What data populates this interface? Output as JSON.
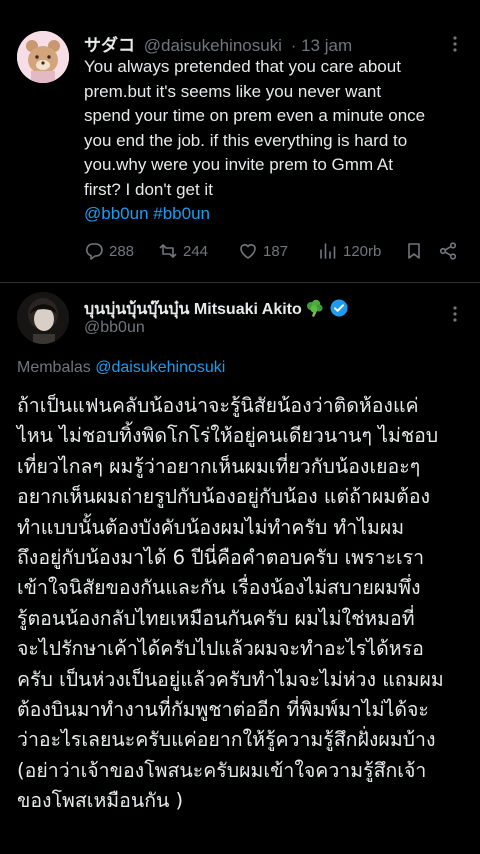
{
  "tweet1": {
    "display_name": "サダコ",
    "handle": "@daisukehinosuki",
    "time": "· 13 jam",
    "lines": [
      "You always pretended that you care about",
      "prem.but it's seems like you never want",
      "spend your time on prem  even a minute once",
      "you end the job. if this everything is hard to",
      "you.why were you invite prem to Gmm At",
      "first? I don't get it"
    ],
    "hashtags": "@bb0un #bb0un",
    "replies": "288",
    "retweets": "244",
    "likes": "187",
    "views": "120rb"
  },
  "tweet2": {
    "display_name": "บุนบุ่นบุ้นบุ๊นบุ๋น Mitsuaki Akito",
    "handle": "@bb0un",
    "reply_prefix": "Membalas",
    "reply_to": "@daisukehinosuki",
    "lines": [
      "ถ้าเป็นแฟนคลับน้องน่าจะรู้นิสัยน้องว่าติดห้องแค่",
      "ไหน ไม่ชอบทิ้งพิดโกโร่ให้อยู่คนเดียวนานๆ ไม่ชอบ",
      "เที่ยวไกลๆ ผมรู้ว่าอยากเห็นผมเที่ยวกับน้องเยอะๆ",
      "อยากเห็นผมถ่ายรูปกับน้องอยู่กับน้อง แต่ถ้าผมต้อง",
      "ทำแบบนั้นต้องบังคับน้องผมไม่ทำครับ ทำไมผม",
      "ถึงอยู่กับน้องมาได้ 6 ปีนี่คือคำตอบครับ เพราะเรา",
      "เข้าใจนิสัยของกันและกัน เรื่องน้องไม่สบายผมพึ่ง",
      "รู้ตอนน้องกลับไทยเหมือนกันครับ ผมไม่ใช่หมอที่",
      "จะไปรักษาเค้าได้ครับไปแล้วผมจะทำอะไรได้หรอ",
      "ครับ เป็นห่วงเป็นอยู่แล้วครับทำไมจะไม่ห่วง แถมผม",
      "ต้องบินมาทำงานที่กัมพูชาต่ออีก ที่พิมพ์มาไม่ได้จะ",
      "ว่าอะไรเลยนะครับแค่อยากให้รู้ความรู้สึกฝั่งผมบ้าง",
      "(อย่าว่าเจ้าของโพสนะครับผมเข้าใจความรู้สึกเจ้า",
      "ของโพสเหมือนกัน )"
    ]
  },
  "colors": {
    "background": "#000000",
    "text": "#e7e9ea",
    "muted": "#71767b",
    "link": "#1d9bf0",
    "verified": "#1d9bf0"
  },
  "icons": [
    "more-icon",
    "reply-icon",
    "retweet-icon",
    "like-icon",
    "views-icon",
    "bookmark-icon",
    "share-icon",
    "broccoli-emoji-icon",
    "verified-badge-icon"
  ]
}
